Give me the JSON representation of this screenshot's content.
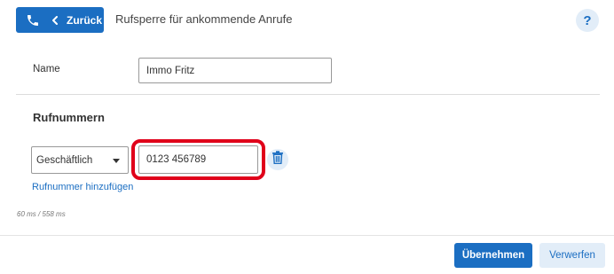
{
  "header": {
    "back_label": "Zurück",
    "title": "Rufsperre für ankommende Anrufe",
    "help_label": "?"
  },
  "form": {
    "name_label": "Name",
    "name_value": "Immo Fritz",
    "section_title": "Rufnummern",
    "number_type": "Geschäftlich",
    "number_value": "0123 456789",
    "add_number_label": "Rufnummer hinzufügen"
  },
  "timing": "60 ms / 558 ms",
  "footer": {
    "apply_label": "Übernehmen",
    "discard_label": "Verwerfen"
  },
  "colors": {
    "accent": "#1b6ec2",
    "accent_light": "#e2edf8",
    "highlight": "#e0001a"
  },
  "icons": {
    "back": "phone-icon",
    "chevron": "chevron-left-icon",
    "delete": "trash-icon",
    "dropdown": "caret-down-icon"
  }
}
